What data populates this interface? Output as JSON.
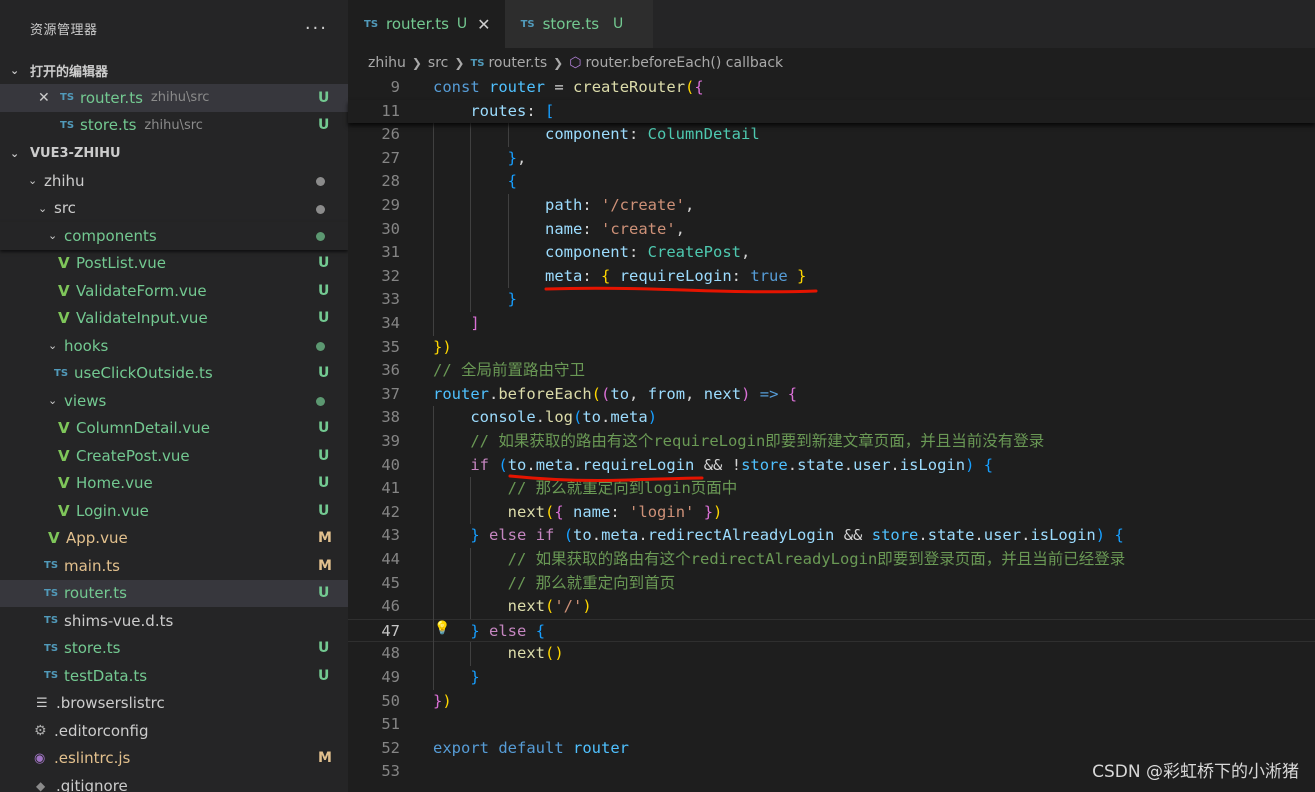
{
  "sidebar": {
    "title": "资源管理器",
    "more": "···",
    "open_editors": {
      "heading": "打开的编辑器",
      "items": [
        {
          "name": "router.ts",
          "path": "zhihu\\src",
          "status": "U"
        },
        {
          "name": "store.ts",
          "path": "zhihu\\src",
          "status": "U"
        }
      ]
    },
    "project": {
      "heading": "VUE3-ZHIHU",
      "tree": [
        {
          "name": "zhihu"
        },
        {
          "name": "src"
        },
        {
          "name": "components"
        },
        {
          "name": "PostList.vue",
          "status": "U"
        },
        {
          "name": "ValidateForm.vue",
          "status": "U"
        },
        {
          "name": "ValidateInput.vue",
          "status": "U"
        },
        {
          "name": "hooks"
        },
        {
          "name": "useClickOutside.ts",
          "status": "U"
        },
        {
          "name": "views"
        },
        {
          "name": "ColumnDetail.vue",
          "status": "U"
        },
        {
          "name": "CreatePost.vue",
          "status": "U"
        },
        {
          "name": "Home.vue",
          "status": "U"
        },
        {
          "name": "Login.vue",
          "status": "U"
        },
        {
          "name": "App.vue",
          "status": "M"
        },
        {
          "name": "main.ts",
          "status": "M"
        },
        {
          "name": "router.ts",
          "status": "U"
        },
        {
          "name": "shims-vue.d.ts"
        },
        {
          "name": "store.ts",
          "status": "U"
        },
        {
          "name": "testData.ts",
          "status": "U"
        },
        {
          "name": ".browserslistrc"
        },
        {
          "name": ".editorconfig"
        },
        {
          "name": ".eslintrc.js",
          "status": "M"
        },
        {
          "name": ".gitignore"
        }
      ]
    }
  },
  "tabs": [
    {
      "icon": "TS",
      "label": "router.ts",
      "status": "U",
      "close": "✕"
    },
    {
      "icon": "TS",
      "label": "store.ts",
      "status": "U"
    }
  ],
  "breadcrumb": [
    "zhihu",
    "src",
    "router.ts",
    "router.beforeEach() callback"
  ],
  "code": {
    "line_numbers": [
      "9",
      "11",
      "26",
      "27",
      "28",
      "29",
      "30",
      "31",
      "32",
      "33",
      "34",
      "35",
      "36",
      "37",
      "38",
      "39",
      "40",
      "41",
      "42",
      "43",
      "44",
      "45",
      "46",
      "47",
      "48",
      "49",
      "50",
      "51",
      "52",
      "53"
    ],
    "lines": [
      "const router = createRouter({",
      "    routes: [",
      "            component: ColumnDetail",
      "        },",
      "        {",
      "            path: '/create',",
      "            name: 'create',",
      "            component: CreatePost,",
      "            meta: { requireLogin: true }",
      "        }",
      "    ]",
      "})",
      "// 全局前置路由守卫",
      "router.beforeEach((to, from, next) => {",
      "    console.log(to.meta)",
      "    // 如果获取的路由有这个requireLogin即要到新建文章页面，并且当前没有登录",
      "    if (to.meta.requireLogin && !store.state.user.isLogin) {",
      "        // 那么就重定向到login页面中",
      "        next({ name: 'login' })",
      "    } else if (to.meta.redirectAlreadyLogin && store.state.user.isLogin) {",
      "        // 如果获取的路由有这个redirectAlreadyLogin即要到登录页面，并且当前已经登录",
      "        // 那么就重定向到首页",
      "        next('/')",
      "    } else {",
      "        next()",
      "    }",
      "})",
      "",
      "export default router",
      ""
    ]
  },
  "watermark": "CSDN @彩虹桥下的小淅猪",
  "colors": {
    "untracked": "#73c991",
    "modified": "#e2c08d",
    "annotation": "#e51400"
  }
}
